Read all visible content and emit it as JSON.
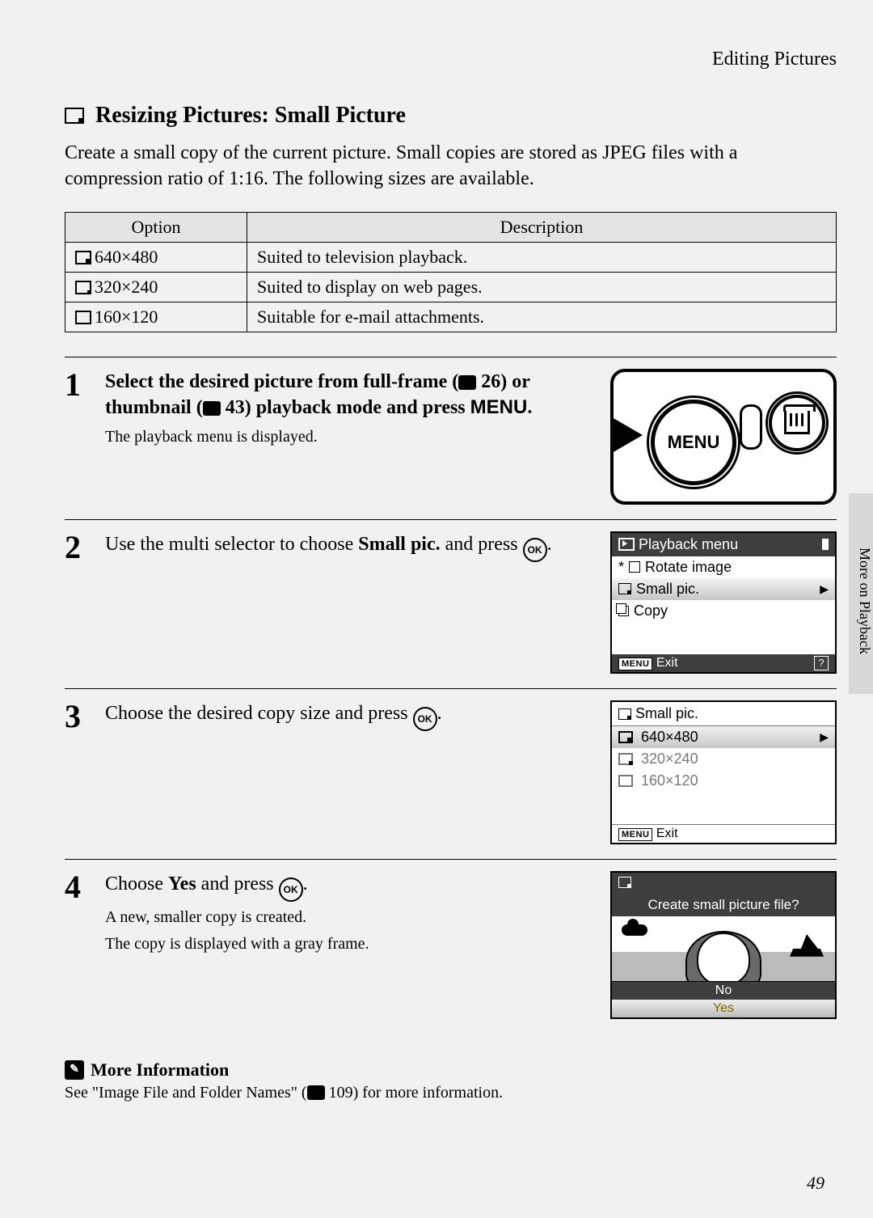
{
  "header": {
    "section": "Editing Pictures"
  },
  "title": "Resizing Pictures: Small Picture",
  "intro": "Create a small copy of the current picture. Small copies are stored as JPEG files with a compression ratio of 1:16. The following sizes are available.",
  "table": {
    "col_option": "Option",
    "col_desc": "Description",
    "rows": [
      {
        "option": "640×480",
        "desc": "Suited to television playback."
      },
      {
        "option": "320×240",
        "desc": "Suited to display on web pages."
      },
      {
        "option": "160×120",
        "desc": "Suitable for e-mail attachments."
      }
    ]
  },
  "steps": {
    "s1": {
      "num": "1",
      "line_a": "Select the desired picture from full-frame (",
      "ref1": "26",
      "line_b": ") or thumbnail (",
      "ref2": "43",
      "line_c": ") playback mode and press ",
      "menu": "MENU",
      "period": ".",
      "sub": "The playback menu is displayed."
    },
    "s2": {
      "num": "2",
      "line_a": "Use the multi selector to choose ",
      "bold": "Small pic.",
      "line_b": " and press ",
      "ok": "OK",
      "period": "."
    },
    "s3": {
      "num": "3",
      "line_a": "Choose the desired copy size and press ",
      "ok": "OK",
      "period": "."
    },
    "s4": {
      "num": "4",
      "line_a": "Choose ",
      "bold": "Yes",
      "line_b": " and press ",
      "ok": "OK",
      "period": ".",
      "sub1": "A new, smaller copy is created.",
      "sub2": "The copy is displayed with a gray frame."
    }
  },
  "screens": {
    "playback_menu": {
      "title": "Playback menu",
      "items": {
        "rotate": "Rotate image",
        "small": "Small pic.",
        "copy": "Copy"
      },
      "exit": "Exit"
    },
    "smallpic_menu": {
      "title": "Small pic.",
      "opt1": "640×480",
      "opt2": "320×240",
      "opt3": "160×120",
      "exit": "Exit"
    },
    "confirm": {
      "question": "Create small picture file?",
      "no": "No",
      "yes": "Yes"
    },
    "camera_menu_label": "MENU"
  },
  "more_info": {
    "heading": "More Information",
    "text_a": "See \"Image File and Folder Names\" (",
    "ref": "109",
    "text_b": ") for more information."
  },
  "sidebar_tab": "More on Playback",
  "page_number": "49"
}
